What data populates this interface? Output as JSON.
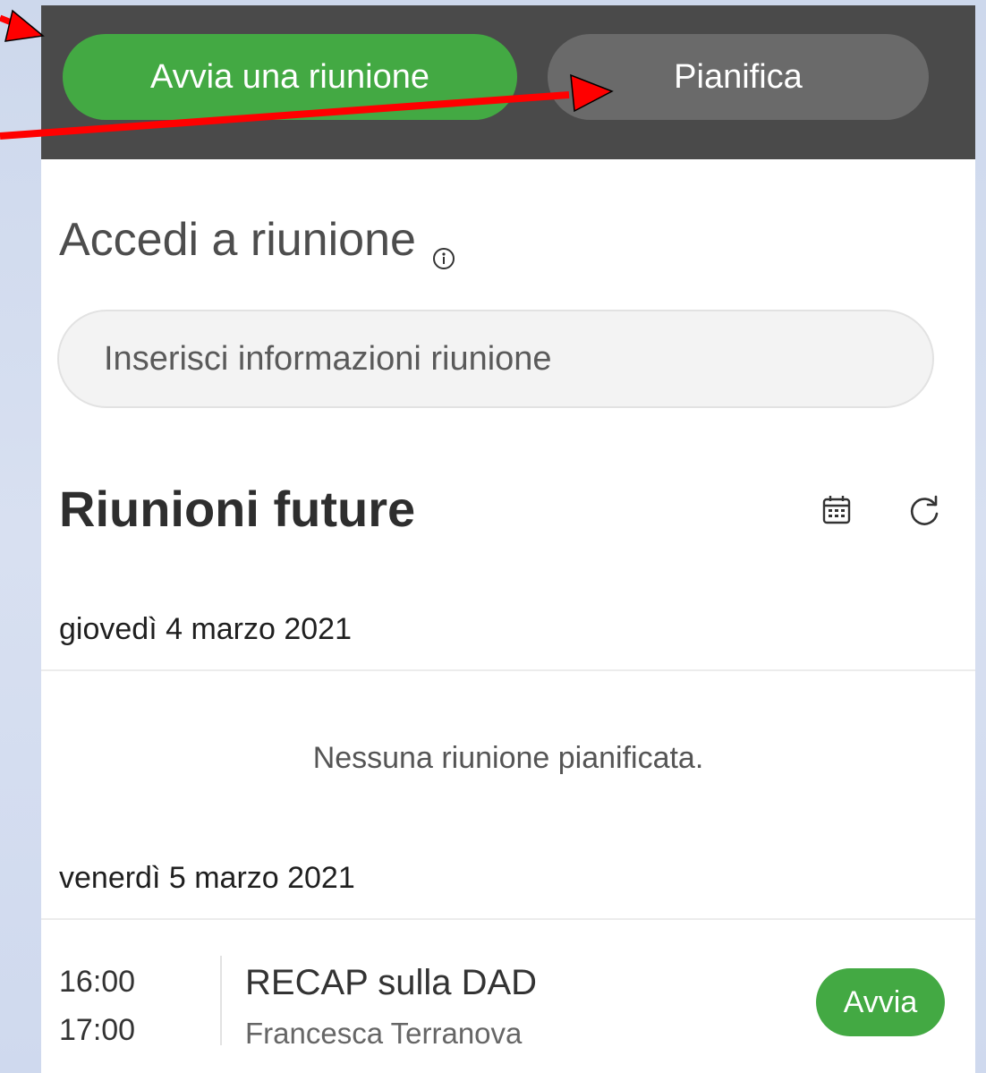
{
  "topbar": {
    "start_meeting_label": "Avvia una riunione",
    "schedule_label": "Pianifica"
  },
  "join": {
    "title": "Accedi a riunione",
    "placeholder": "Inserisci informazioni riunione"
  },
  "upcoming": {
    "title": "Riunioni future",
    "days": [
      {
        "date": "giovedì 4 marzo 2021",
        "empty_message": "Nessuna riunione pianificata."
      },
      {
        "date": "venerdì 5 marzo 2021",
        "meetings": [
          {
            "start": "16:00",
            "end": "17:00",
            "title": "RECAP sulla DAD",
            "organizer": "Francesca Terranova",
            "action_label": "Avvia"
          }
        ]
      }
    ]
  },
  "colors": {
    "accent_green": "#43a943",
    "topbar": "#4a4a4a",
    "secondary_button": "#6a6a6a",
    "annotation_arrow": "#ff0000"
  },
  "icons": [
    "info-icon",
    "calendar-icon",
    "refresh-icon",
    "annotation-arrow"
  ]
}
